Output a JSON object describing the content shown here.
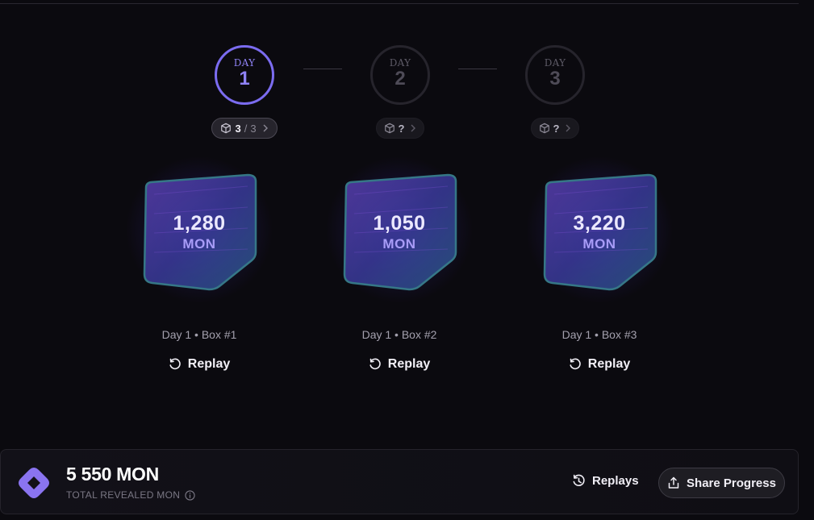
{
  "days": [
    {
      "label": "DAY",
      "number": "1",
      "pill_count": "3",
      "pill_sep": "/",
      "pill_total": "3",
      "active": true
    },
    {
      "label": "DAY",
      "number": "2",
      "pill_q": "?",
      "active": false
    },
    {
      "label": "DAY",
      "number": "3",
      "pill_q": "?",
      "active": false
    }
  ],
  "boxes": [
    {
      "value": "1,280",
      "unit": "MON",
      "caption": "Day 1 • Box #1",
      "replay_label": "Replay"
    },
    {
      "value": "1,050",
      "unit": "MON",
      "caption": "Day 1 • Box #2",
      "replay_label": "Replay"
    },
    {
      "value": "3,220",
      "unit": "MON",
      "caption": "Day 1 • Box #3",
      "replay_label": "Replay"
    }
  ],
  "footer": {
    "total_value": "5 550 MON",
    "total_label": "TOTAL REVEALED MON",
    "replays_label": "Replays",
    "share_label": "Share Progress"
  },
  "colors": {
    "accent": "#7b6cf0",
    "background": "#0b0a0f",
    "unit": "#a89cf7"
  },
  "icons": [
    "cube-icon",
    "chevron-right-icon",
    "replay-icon",
    "history-icon",
    "share-icon",
    "info-icon",
    "logo-icon"
  ]
}
